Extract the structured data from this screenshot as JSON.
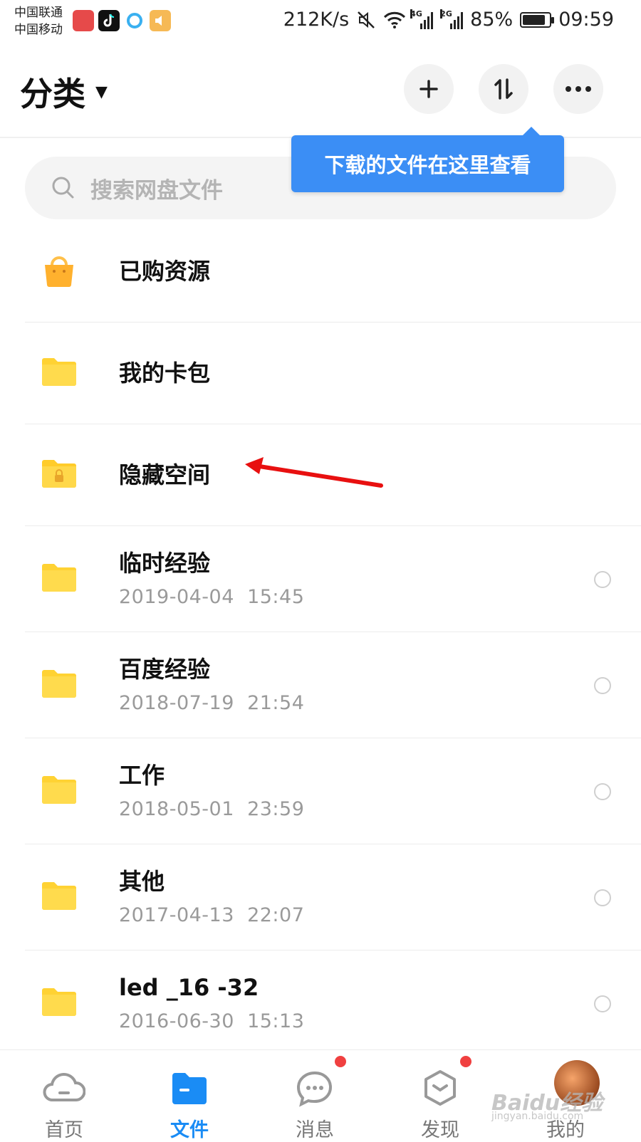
{
  "status_bar": {
    "carrier_1": "中国联通",
    "carrier_2": "中国移动",
    "net_speed": "212K/s",
    "net_type_1": "4G",
    "net_type_2": "2G",
    "battery": "85%",
    "battery_level": 0.85,
    "time": "09:59"
  },
  "header": {
    "title": "分类",
    "add_icon": "plus-icon",
    "transfer_icon": "transfer-icon",
    "more_icon": "more-icon"
  },
  "tooltip": {
    "text": "下载的文件在这里查看"
  },
  "search": {
    "placeholder": "搜索网盘文件"
  },
  "folders": [
    {
      "name": "已购资源",
      "icon": "shopping-bag-icon"
    },
    {
      "name": "我的卡包",
      "icon": "folder-icon"
    },
    {
      "name": "隐藏空间",
      "icon": "locked-folder-icon"
    },
    {
      "name": "临时经验",
      "date": "2019-04-04  15:45",
      "icon": "folder-icon"
    },
    {
      "name": "百度经验",
      "date": "2018-07-19  21:54",
      "icon": "folder-icon"
    },
    {
      "name": "工作",
      "date": "2018-05-01  23:59",
      "icon": "folder-icon"
    },
    {
      "name": "其他",
      "date": "2017-04-13  22:07",
      "icon": "folder-icon"
    },
    {
      "name": "led _16 -32",
      "date": "2016-06-30  15:13",
      "icon": "folder-icon"
    }
  ],
  "tabs": [
    {
      "label": "首页",
      "icon": "cloud-icon"
    },
    {
      "label": "文件",
      "icon": "file-folder-icon",
      "active": true
    },
    {
      "label": "消息",
      "icon": "chat-icon",
      "badge": true
    },
    {
      "label": "发现",
      "icon": "cube-icon",
      "badge": true
    },
    {
      "label": "我的",
      "icon": "avatar"
    }
  ],
  "watermark": {
    "line1": "Baidu经验",
    "line2": "jingyan.baidu.com"
  },
  "colors": {
    "accent": "#1a8cf5",
    "tooltip": "#3b8ef5",
    "folder": "#ffd233",
    "annotation_arrow": "#e81010",
    "badge": "#f04040"
  }
}
